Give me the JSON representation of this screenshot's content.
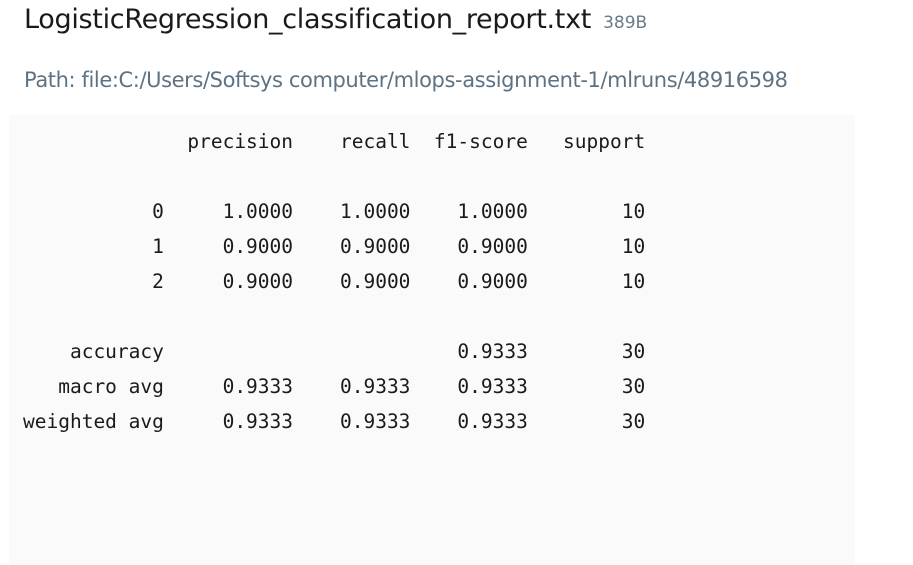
{
  "artifact": {
    "filename": "LogisticRegression_classification_report.txt",
    "size": "389B",
    "path": "Path: file:C:/Users/Softsys computer/mlops-assignment-1/mlruns/48916598"
  },
  "report_lines": [
    "              precision    recall  f1-score   support",
    "",
    "           0     1.0000    1.0000    1.0000        10",
    "           1     0.9000    0.9000    0.9000        10",
    "           2     0.9000    0.9000    0.9000        10",
    "",
    "    accuracy                         0.9333        30",
    "   macro avg     0.9333    0.9333    0.9333        30",
    "weighted avg     0.9333    0.9333    0.9333        30"
  ]
}
